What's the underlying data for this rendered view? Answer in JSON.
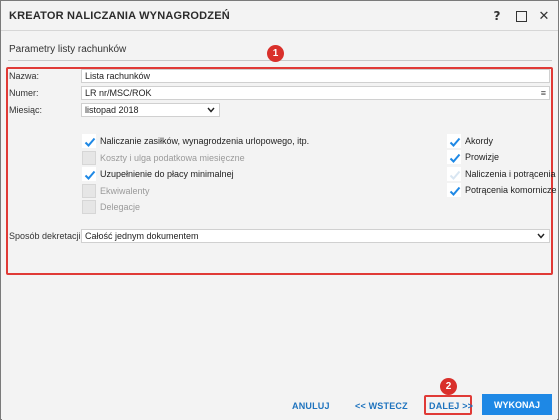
{
  "window": {
    "title": "KREATOR NALICZANIA WYNAGRODZEŃ",
    "help_label": "?",
    "close_label": "✕"
  },
  "section": {
    "title": "Parametry listy rachunków"
  },
  "badges": {
    "first": "1",
    "second": "2"
  },
  "form": {
    "name_label": "Nazwa:",
    "name_value": "Lista rachunków",
    "number_label": "Numer:",
    "number_value": "LR nr/MSC/ROK",
    "month_label": "Miesiąc:",
    "month_value": "listopad 2018",
    "posting_label": "Sposób dekretacji:",
    "posting_value": "Całość jednym dokumentem"
  },
  "options_left": [
    {
      "label": "Naliczanie zasiłków, wynagrodzenia urlopowego, itp.",
      "checked": true
    },
    {
      "label": "Koszty i ulga podatkowa miesięczne",
      "checked": false
    },
    {
      "label": "Uzupełnienie do płacy minimalnej",
      "checked": true
    },
    {
      "label": "Ekwiwalenty",
      "checked": false
    },
    {
      "label": "Delegacje",
      "checked": false
    }
  ],
  "options_right": [
    {
      "label": "Akordy",
      "checked": true
    },
    {
      "label": "Prowizje",
      "checked": true
    },
    {
      "label": "Naliczenia i potrącenia",
      "checked": false
    },
    {
      "label": "Potrącenia komornicze",
      "checked": true
    }
  ],
  "footer": {
    "cancel_label": "ANULUJ",
    "back_label": "<< WSTECZ",
    "next_label": "DALEJ >>",
    "execute_label": "WYKONAJ"
  },
  "colors": {
    "accent": "#1e88e5",
    "highlight": "#e03a36",
    "link": "#1e73be"
  }
}
